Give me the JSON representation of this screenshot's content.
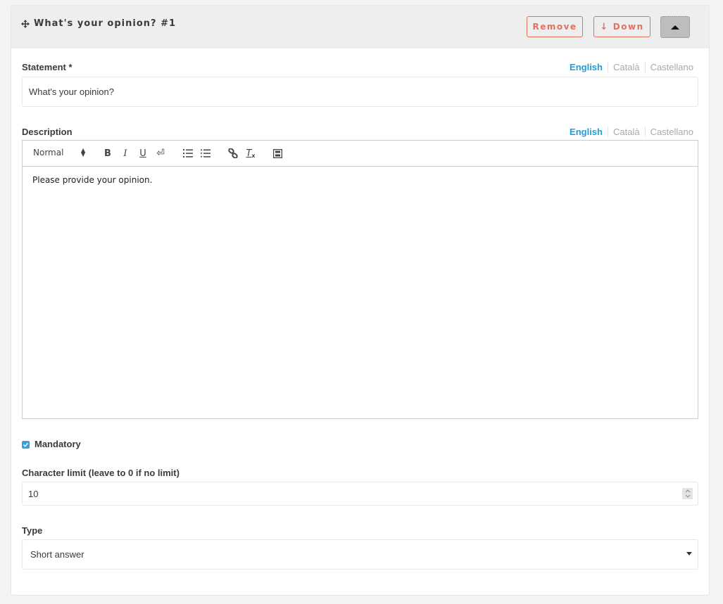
{
  "header": {
    "title": "What's your opinion? #1",
    "move_icon": "move-arrows-icon",
    "remove_label": "Remove",
    "down_label": "Down",
    "down_icon": "arrow-down-icon",
    "collapse_icon": "caret-up-icon"
  },
  "colors": {
    "accent": "#1b9fdb",
    "danger": "#e4715e",
    "header_bg": "#eeeeee",
    "checkbox": "#3aa0dc"
  },
  "languages": [
    {
      "label": "English",
      "active": true
    },
    {
      "label": "Català",
      "active": false
    },
    {
      "label": "Castellano",
      "active": false
    }
  ],
  "statement": {
    "label": "Statement *",
    "value": "What's your opinion?"
  },
  "description": {
    "label": "Description",
    "toolbar": {
      "format_select": "Normal",
      "buttons": [
        "bold-icon",
        "italic-icon",
        "underline-icon",
        "linebreak-icon",
        "ordered-list-icon",
        "bullet-list-icon",
        "link-icon",
        "clear-format-icon",
        "video-icon"
      ]
    },
    "content": "Please provide your opinion."
  },
  "mandatory": {
    "label": "Mandatory",
    "checked": true
  },
  "character_limit": {
    "label": "Character limit (leave to 0 if no limit)",
    "value": "10"
  },
  "type": {
    "label": "Type",
    "selected": "Short answer"
  }
}
